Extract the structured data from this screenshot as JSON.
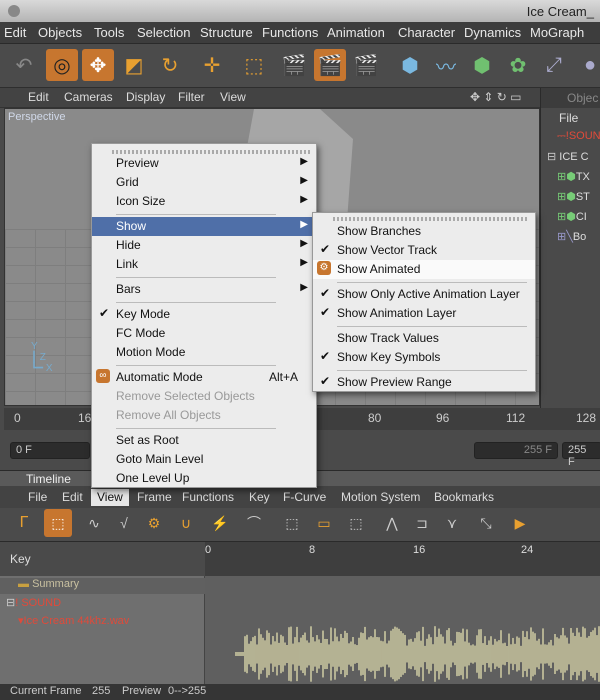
{
  "window": {
    "title": "Ice Cream_"
  },
  "menubar": [
    "Edit",
    "Objects",
    "Tools",
    "Selection",
    "Structure",
    "Functions",
    "Animation",
    "Character",
    "Dynamics",
    "MoGraph"
  ],
  "viewport_menu": [
    "Edit",
    "Cameras",
    "Display",
    "Filter",
    "View"
  ],
  "viewport": {
    "label": "Perspective"
  },
  "object_manager": {
    "menu_file": "File",
    "tab": "Objec",
    "items": [
      {
        "label": "SOUN",
        "color": "#e04a3a"
      },
      {
        "label": "ICE C",
        "color": "#dddddd"
      },
      {
        "label": "TX",
        "color": "#dddddd"
      },
      {
        "label": "ST",
        "color": "#dddddd"
      },
      {
        "label": "CI",
        "color": "#dddddd"
      },
      {
        "label": "Bo",
        "color": "#dddddd"
      }
    ]
  },
  "ruler": {
    "ticks": [
      "0",
      "16",
      "80",
      "96",
      "112",
      "128"
    ]
  },
  "frame_fields": {
    "start": "0 F",
    "end_partial": "255 F",
    "end": "255 F"
  },
  "timeline": {
    "title": "Timeline",
    "menu": [
      "File",
      "Edit",
      "View",
      "Frame",
      "Functions",
      "Key",
      "F-Curve",
      "Motion System",
      "Bookmarks"
    ],
    "selected_menu": "View",
    "key_header": "Key",
    "ruler_ticks": [
      "0",
      "8",
      "16",
      "24"
    ],
    "tracks": [
      {
        "label": "Summary",
        "color": "#c8c0a0"
      },
      {
        "label": "SOUND",
        "color": "#e04a3a"
      },
      {
        "label": "Ice Cream 44khz.wav",
        "color": "#e04a3a"
      }
    ]
  },
  "status": {
    "current_frame_label": "Current Frame",
    "current_frame": "255",
    "preview_label": "Preview",
    "preview_range": "0-->255"
  },
  "view_menu": {
    "items": [
      {
        "label": "Preview",
        "submenu": true
      },
      {
        "label": "Grid",
        "submenu": true
      },
      {
        "label": "Icon Size",
        "submenu": true
      },
      {
        "label": "Show",
        "submenu": true,
        "highlighted": true
      },
      {
        "label": "Hide",
        "submenu": true
      },
      {
        "label": "Link",
        "submenu": true
      },
      {
        "label": "Bars",
        "submenu": true
      },
      {
        "label": "Key Mode",
        "checked": true
      },
      {
        "label": "FC Mode"
      },
      {
        "label": "Motion Mode"
      },
      {
        "label": "Automatic Mode",
        "shortcut": "Alt+A",
        "icon": true
      },
      {
        "label": "Remove Selected Objects",
        "disabled": true
      },
      {
        "label": "Remove All Objects",
        "disabled": true
      },
      {
        "label": "Set as Root"
      },
      {
        "label": "Goto Main Level"
      },
      {
        "label": "One Level Up"
      }
    ]
  },
  "show_submenu": {
    "items": [
      {
        "label": "Show Branches"
      },
      {
        "label": "Show Vector Track",
        "checked": true
      },
      {
        "label": "Show Animated",
        "hover": true,
        "icon": true
      },
      {
        "label": "Show Only Active Animation Layer",
        "checked": true
      },
      {
        "label": "Show Animation Layer",
        "checked": true
      },
      {
        "label": "Show Track Values"
      },
      {
        "label": "Show Key Symbols",
        "checked": true
      },
      {
        "label": "Show Preview Range",
        "checked": true
      }
    ]
  },
  "colors": {
    "accent": "#c7762f",
    "highlight": "#4f6fa8",
    "wave": "#c9c6a0",
    "red_text": "#e04a3a"
  }
}
